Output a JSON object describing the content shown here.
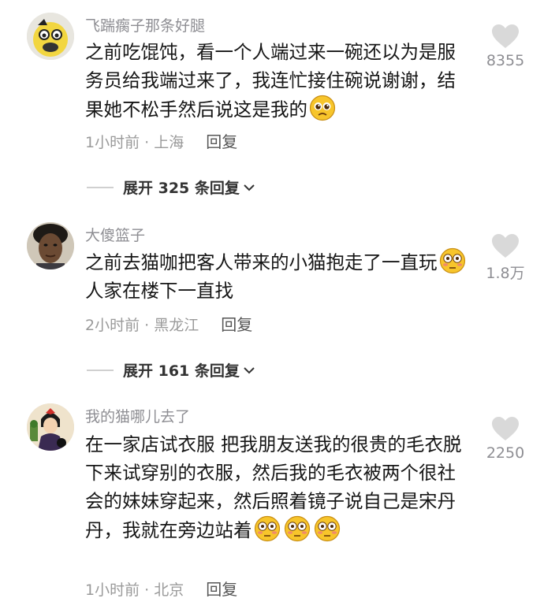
{
  "comments": [
    {
      "username": "飞踹瘸子那条好腿",
      "text": "之前吃馄饨，看一个人端过来一碗还以为是服务员给我端过来了，我连忙接住碗说谢谢，结果她不松手然后说这是我的",
      "meta": "1小时前 · 上海",
      "reply_label": "回复",
      "likes": "8355",
      "expand_label": "展开 325 条回复",
      "avatar_icon": "duck-avatar",
      "emoji": "pleading-face"
    },
    {
      "username": "大傻篮子",
      "text_1": "之前去猫咖把客人带来的小猫抱走了一直玩",
      "text_2": "人家在楼下一直找",
      "meta": "2小时前 · 黑龙江",
      "reply_label": "回复",
      "likes": "1.8万",
      "expand_label": "展开 161 条回复",
      "avatar_icon": "person-avatar",
      "emoji": "flushed-face"
    },
    {
      "username": "我的猫哪儿去了",
      "text": "在一家店试衣服 把我朋友送我的很贵的毛衣脱下来试穿别的衣服，然后我的毛衣被两个很社会的妹妹穿起来，然后照着镜子说自己是宋丹丹，我就在旁边站着",
      "meta": "1小时前 · 北京",
      "reply_label": "回复",
      "likes": "2250",
      "avatar_icon": "girl-cat-avatar",
      "emoji": "flushed-face"
    }
  ],
  "colors": {
    "text": "#161616",
    "secondary": "#8e8e93",
    "heart": "#d9d9d9",
    "emoji": "#f7c52b"
  }
}
